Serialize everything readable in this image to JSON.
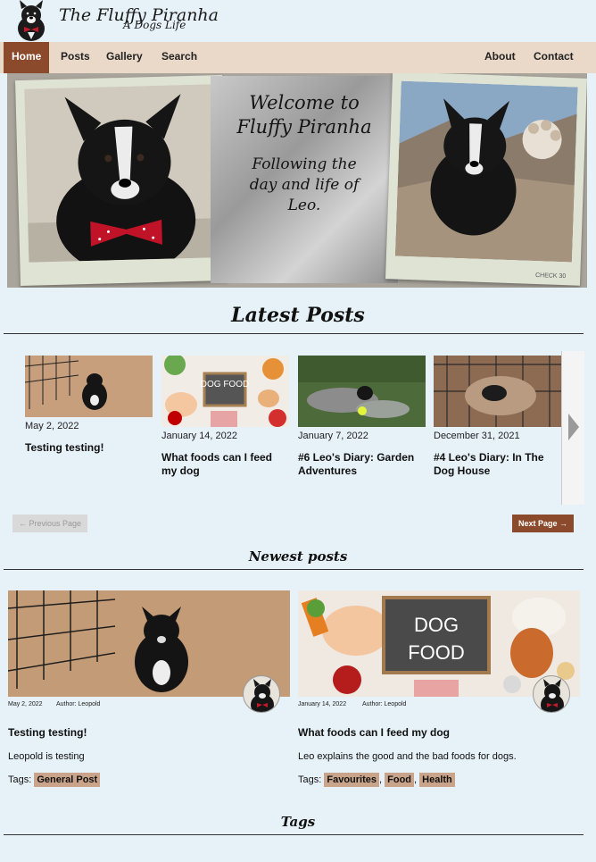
{
  "header": {
    "title": "The Fluffy Piranha",
    "subtitle": "A Dogs Life",
    "logo_icon": "dog-logo-icon"
  },
  "nav": {
    "items": [
      {
        "label": "Home",
        "active": true
      },
      {
        "label": "Posts"
      },
      {
        "label": "Gallery"
      },
      {
        "label": "Search"
      },
      {
        "label": "About"
      },
      {
        "label": "Contact"
      }
    ]
  },
  "hero": {
    "welcome_line1": "Welcome to",
    "welcome_line2": "Fluffy Piranha",
    "tag_line1": "Following the",
    "tag_line2": "day and life of",
    "tag_line3": "Leo.",
    "photo2_caption": "CHECK 30"
  },
  "latest": {
    "heading": "Latest Posts",
    "items": [
      {
        "date": "May 2, 2022",
        "title": "Testing testing!"
      },
      {
        "date": "January 14, 2022",
        "title": "What foods can I feed my dog"
      },
      {
        "date": "January 7, 2022",
        "title": "#6 Leo's Diary: Garden Adventures"
      },
      {
        "date": "December 31, 2021",
        "title": "#4 Leo's Diary: In The Dog House"
      }
    ],
    "prev_label": "← Previous Page",
    "next_label": "Next Page →",
    "dog_food_sign": "DOG FOOD"
  },
  "newest": {
    "heading": "Newest posts",
    "posts": [
      {
        "date": "May 2, 2022",
        "author": "Author: Leopold",
        "title": "Testing testing!",
        "excerpt": "Leopold is testing",
        "tags_label": "Tags:",
        "tags": [
          "General Post"
        ]
      },
      {
        "date": "January 14, 2022",
        "author": "Author: Leopold",
        "title": "What foods can I feed my dog",
        "excerpt": "Leo explains the good and the bad foods for dogs.",
        "tags_label": "Tags:",
        "tags": [
          "Favourites",
          "Food",
          "Health"
        ],
        "sign_line1": "DOG",
        "sign_line2": "FOOD"
      }
    ]
  },
  "tags_section": {
    "heading": "Tags"
  },
  "colors": {
    "accent": "#8c4a2c",
    "nav_bg": "#ead8c8",
    "page_bg": "#e6f1f8",
    "tag_bg": "#c9a48a"
  }
}
